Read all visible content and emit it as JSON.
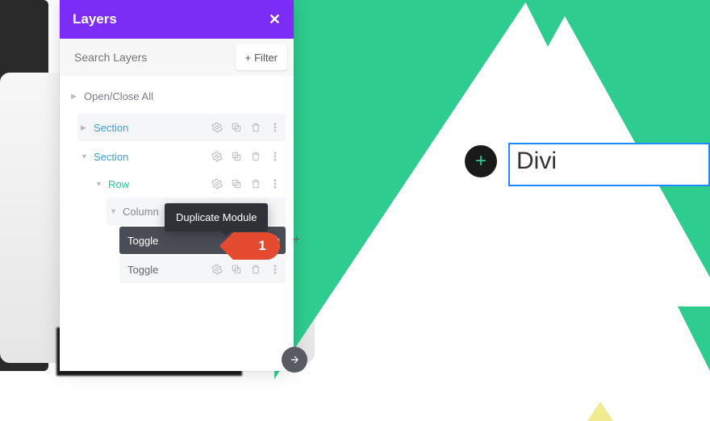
{
  "canvas": {
    "add_module_label": "+",
    "text_field_value": "Divi"
  },
  "panel": {
    "title": "Layers",
    "close_label": "✕",
    "search_placeholder": "Search Layers",
    "filter_label": "Filter",
    "open_close_label": "Open/Close All",
    "tree": [
      {
        "label": "Section"
      },
      {
        "label": "Section"
      },
      {
        "label": "Row"
      },
      {
        "label": "Column"
      },
      {
        "label": "Toggle"
      },
      {
        "label": "Toggle"
      }
    ],
    "tooltip": "Duplicate Module",
    "add_after_label": "+"
  },
  "callout": {
    "number": "1"
  },
  "colors": {
    "accent_purple": "#7b2cf5",
    "accent_green": "#2ecc8f",
    "accent_orange": "#e44a2f",
    "accent_blue": "#1d8bff"
  }
}
